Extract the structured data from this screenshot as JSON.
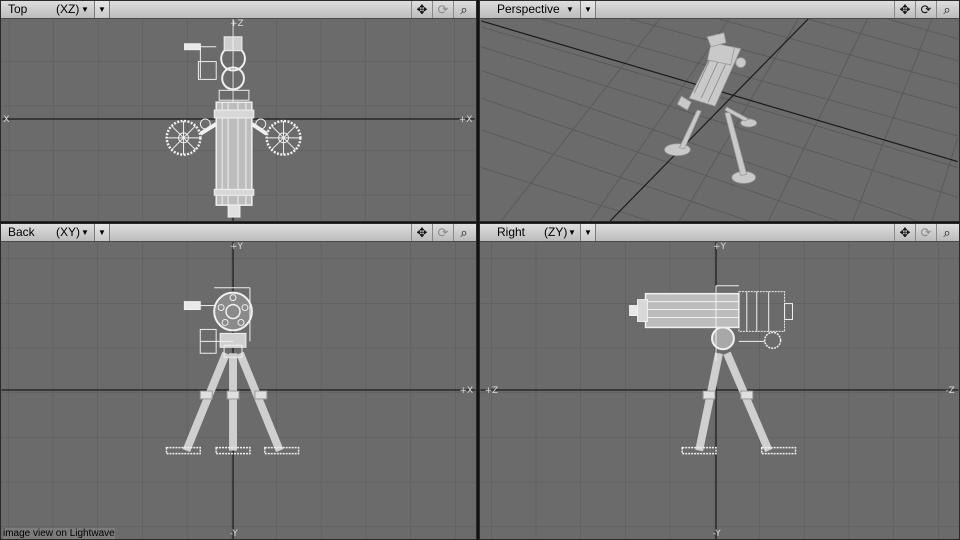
{
  "viewports": {
    "top": {
      "name": "Top",
      "axes": "(XZ)"
    },
    "perspective": {
      "name": "Perspective"
    },
    "back": {
      "name": "Back",
      "axes": "(XY)"
    },
    "right": {
      "name": "Right",
      "axes": "(ZY)"
    }
  },
  "tool_icons": [
    "move-view-icon",
    "rotate-view-icon",
    "zoom-view-icon"
  ],
  "caption": "image view on Lightwave",
  "colors": {
    "viewport_bg": "#6b6b6b",
    "grid": "#5c5c5c",
    "axis": "#1a1a1a",
    "wire": "#f2f2f2",
    "header_bg": "#cdcdcd"
  }
}
